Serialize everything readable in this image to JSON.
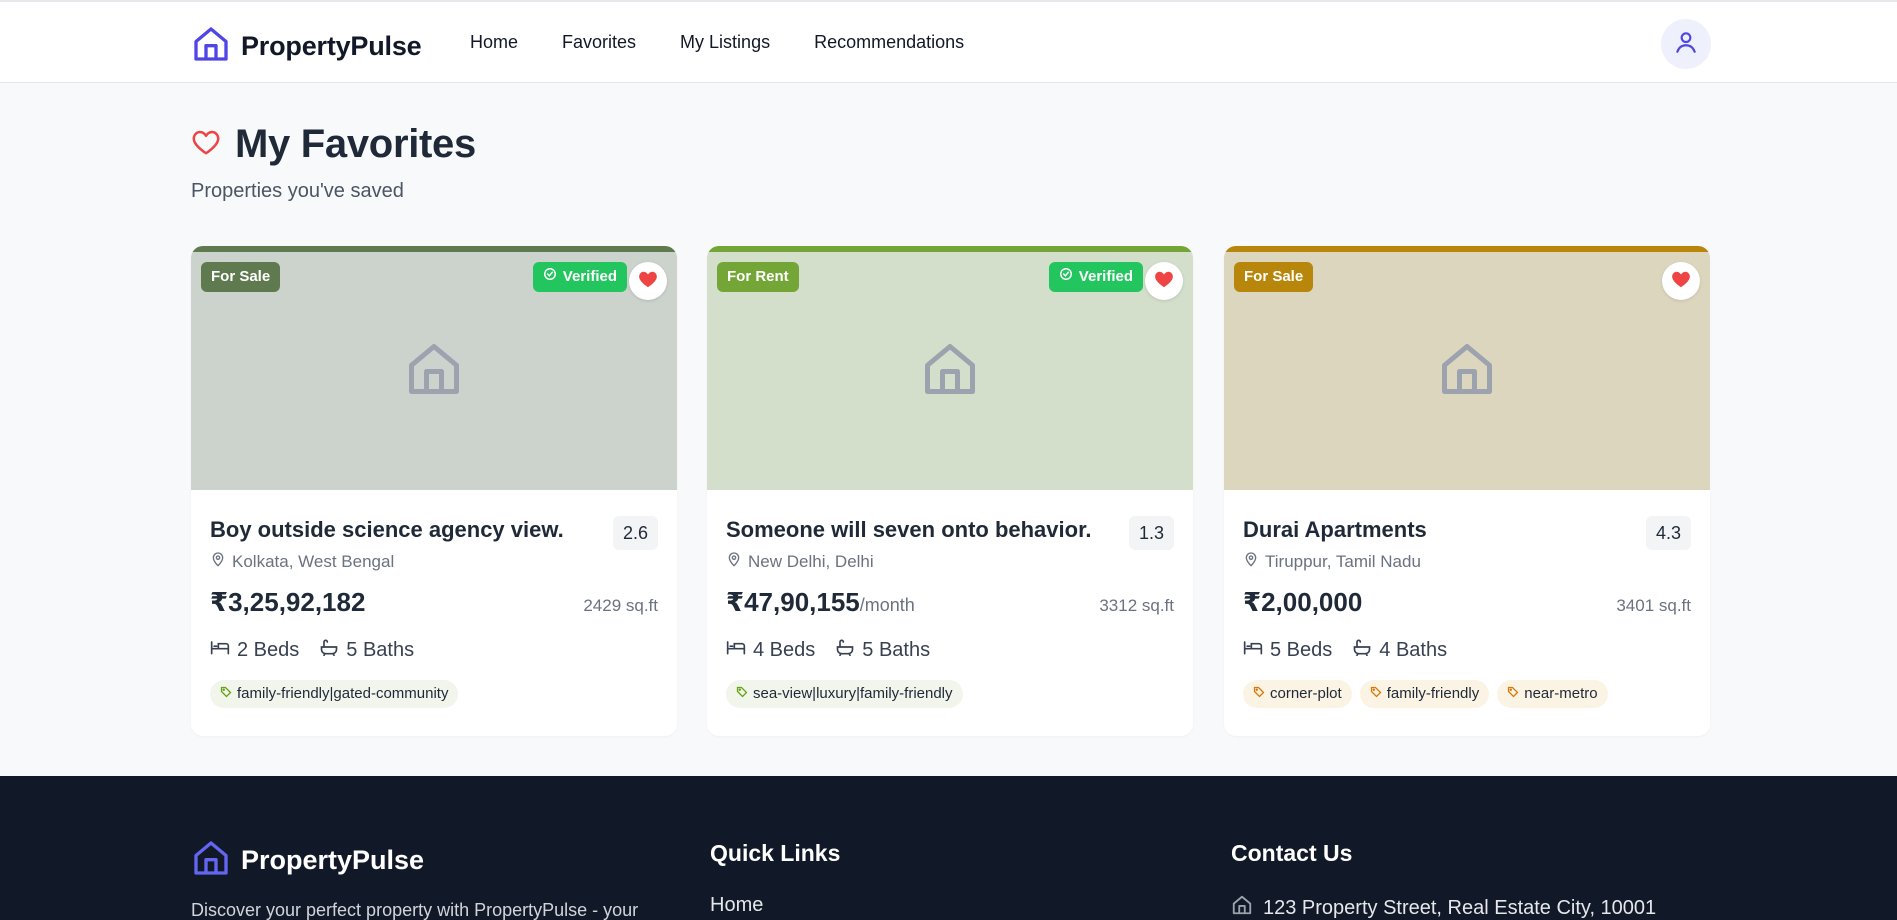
{
  "brand": {
    "name": "PropertyPulse",
    "accent": "#4f46e5"
  },
  "nav": [
    {
      "label": "Home"
    },
    {
      "label": "Favorites"
    },
    {
      "label": "My Listings"
    },
    {
      "label": "Recommendations"
    }
  ],
  "user": {
    "icon": "user-icon"
  },
  "page": {
    "title": "My Favorites",
    "subtitle": "Properties you've saved",
    "title_icon": "heart-outline-icon"
  },
  "listings": [
    {
      "type": "For Sale",
      "type_color": "#5f7a4f",
      "image_bg": "#cbd3cc",
      "verified": "Verified",
      "title": "Boy outside science agency view.",
      "rating": "2.6",
      "location": "Kolkata, West Bengal",
      "price": "₹3,25,92,182",
      "period": "",
      "area": "2429 sq.ft",
      "beds": "2 Beds",
      "baths": "5 Baths",
      "tags": [
        "family-friendly|gated-community"
      ]
    },
    {
      "type": "For Rent",
      "type_color": "#74a637",
      "image_bg": "#d3dfcb",
      "verified": "Verified",
      "title": "Someone will seven onto behavior.",
      "rating": "1.3",
      "location": "New Delhi, Delhi",
      "price": "₹47,90,155",
      "period": "/month",
      "area": "3312 sq.ft",
      "beds": "4 Beds",
      "baths": "5 Baths",
      "tags": [
        "sea-view|luxury|family-friendly"
      ]
    },
    {
      "type": "For Sale",
      "type_color": "#b8860b",
      "image_bg": "#ddd6bf",
      "verified": "",
      "title": "Durai Apartments",
      "rating": "4.3",
      "location": "Tiruppur, Tamil Nadu",
      "price": "₹2,00,000",
      "period": "",
      "area": "3401 sq.ft",
      "beds": "5 Beds",
      "baths": "4 Baths",
      "tags": [
        "corner-plot",
        "family-friendly",
        "near-metro"
      ]
    }
  ],
  "footer": {
    "brand": "PropertyPulse",
    "description": "Discover your perfect property with PropertyPulse - your",
    "quick_links_title": "Quick Links",
    "quick_links": [
      "Home"
    ],
    "contact_title": "Contact Us",
    "address": "123 Property Street, Real Estate City, 10001"
  },
  "colors": {
    "verified": "#22c55e",
    "heart": "#ef4444",
    "footer_bg": "#111827"
  }
}
